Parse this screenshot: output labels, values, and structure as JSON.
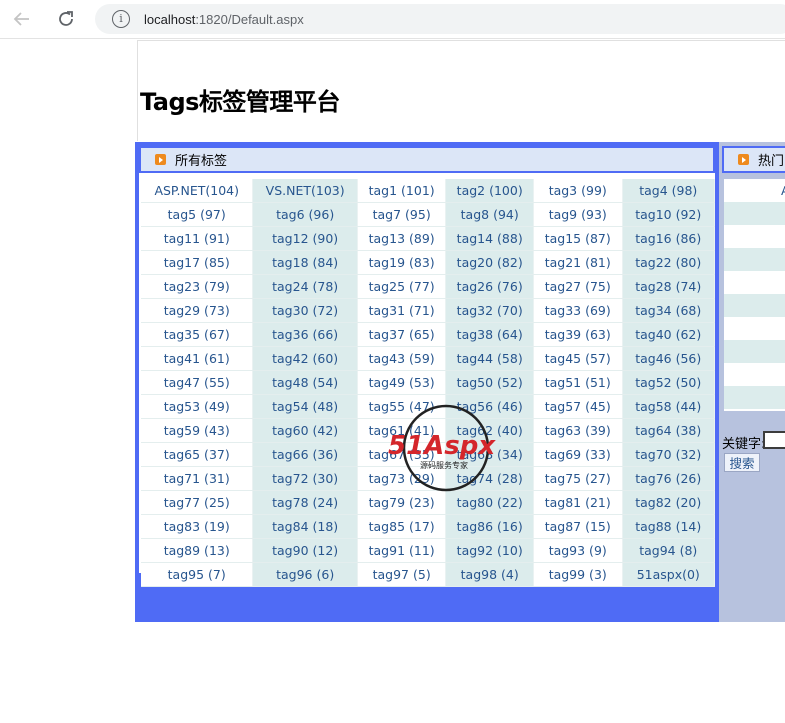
{
  "browser": {
    "url_host": "localhost",
    "url_rest": ":1820/Default.aspx"
  },
  "page": {
    "title": "Tags标签管理平台"
  },
  "panel_all": {
    "header": "所有标签",
    "tags": [
      [
        "ASP.NET(104)",
        "VS.NET(103)",
        "tag1 (101)",
        "tag2 (100)",
        "tag3 (99)",
        "tag4 (98)"
      ],
      [
        "tag5 (97)",
        "tag6 (96)",
        "tag7 (95)",
        "tag8 (94)",
        "tag9 (93)",
        "tag10 (92)"
      ],
      [
        "tag11 (91)",
        "tag12 (90)",
        "tag13 (89)",
        "tag14 (88)",
        "tag15 (87)",
        "tag16 (86)"
      ],
      [
        "tag17 (85)",
        "tag18 (84)",
        "tag19 (83)",
        "tag20 (82)",
        "tag21 (81)",
        "tag22 (80)"
      ],
      [
        "tag23 (79)",
        "tag24 (78)",
        "tag25 (77)",
        "tag26 (76)",
        "tag27 (75)",
        "tag28 (74)"
      ],
      [
        "tag29 (73)",
        "tag30 (72)",
        "tag31 (71)",
        "tag32 (70)",
        "tag33 (69)",
        "tag34 (68)"
      ],
      [
        "tag35 (67)",
        "tag36 (66)",
        "tag37 (65)",
        "tag38 (64)",
        "tag39 (63)",
        "tag40 (62)"
      ],
      [
        "tag41 (61)",
        "tag42 (60)",
        "tag43 (59)",
        "tag44 (58)",
        "tag45 (57)",
        "tag46 (56)"
      ],
      [
        "tag47 (55)",
        "tag48 (54)",
        "tag49 (53)",
        "tag50 (52)",
        "tag51 (51)",
        "tag52 (50)"
      ],
      [
        "tag53 (49)",
        "tag54 (48)",
        "tag55 (47)",
        "tag56 (46)",
        "tag57 (45)",
        "tag58 (44)"
      ],
      [
        "tag59 (43)",
        "tag60 (42)",
        "tag61 (41)",
        "tag62 (40)",
        "tag63 (39)",
        "tag64 (38)"
      ],
      [
        "tag65 (37)",
        "tag66 (36)",
        "tag67 (35)",
        "tag68 (34)",
        "tag69 (33)",
        "tag70 (32)"
      ],
      [
        "tag71 (31)",
        "tag72 (30)",
        "tag73 (29)",
        "tag74 (28)",
        "tag75 (27)",
        "tag76 (26)"
      ],
      [
        "tag77 (25)",
        "tag78 (24)",
        "tag79 (23)",
        "tag80 (22)",
        "tag81 (21)",
        "tag82 (20)"
      ],
      [
        "tag83 (19)",
        "tag84 (18)",
        "tag85 (17)",
        "tag86 (16)",
        "tag87 (15)",
        "tag88 (14)"
      ],
      [
        "tag89 (13)",
        "tag90 (12)",
        "tag91 (11)",
        "tag92 (10)",
        "tag93 (9)",
        "tag94 (8)"
      ],
      [
        "tag95 (7)",
        "tag96 (6)",
        "tag97 (5)",
        "tag98 (4)",
        "tag99 (3)",
        "51aspx(0)"
      ]
    ]
  },
  "panel_hot": {
    "header": "热门",
    "first_item": "A"
  },
  "search": {
    "label": "关键字:",
    "button": "搜索"
  },
  "watermark": {
    "brand": "51Aspx",
    "tagline": "源码服务专家"
  },
  "colors": {
    "frame_blue": "#4f6bf5",
    "header_bg": "#dce6f7",
    "alt_column": "#dcecec",
    "link": "#27558e",
    "side_panel": "#b7c2de"
  },
  "icons": [
    "back-arrow-icon",
    "reload-icon",
    "info-icon",
    "header-arrow-icon"
  ]
}
